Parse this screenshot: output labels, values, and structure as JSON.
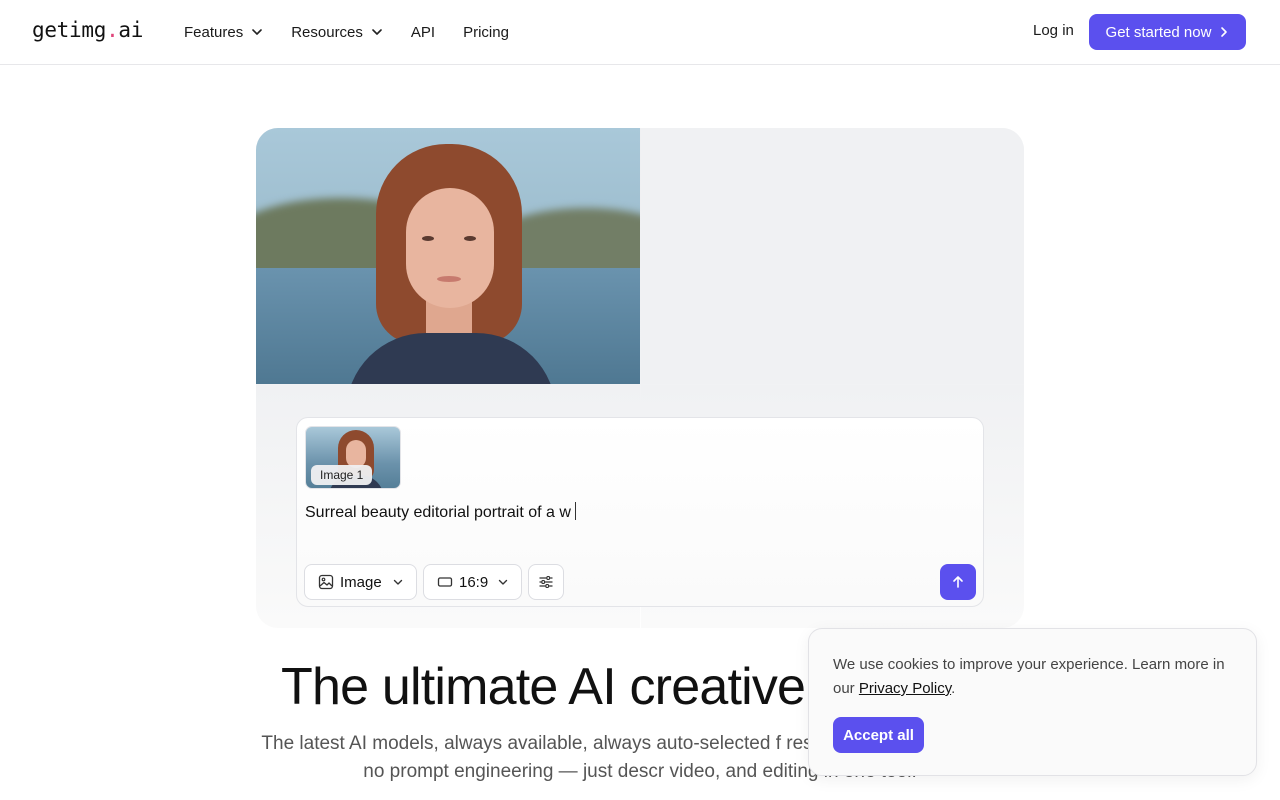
{
  "header": {
    "logo_main": "getimg",
    "logo_dot": ".",
    "logo_tld": "ai",
    "nav": [
      {
        "label": "Features",
        "has_dropdown": true
      },
      {
        "label": "Resources",
        "has_dropdown": true
      },
      {
        "label": "API",
        "has_dropdown": false
      },
      {
        "label": "Pricing",
        "has_dropdown": false
      }
    ],
    "login_label": "Log in",
    "cta_label": "Get started now"
  },
  "prompt": {
    "attachment_label": "Image 1",
    "text": "Surreal beauty editorial portrait of a w",
    "mode_label": "Image",
    "ratio_label": "16:9"
  },
  "hero": {
    "headline": "The ultimate AI creative",
    "subtitle": "The latest AI models, always available, always auto-selected f research, no model picking, no prompt engineering — just descr video, and editing in one tool."
  },
  "cookie": {
    "text_before": "We use cookies to improve your experience. Learn more in our ",
    "link_label": "Privacy Policy",
    "text_after": ".",
    "accept_label": "Accept all"
  },
  "colors": {
    "accent": "#5b50ee",
    "logo_dot": "#e0457b"
  }
}
